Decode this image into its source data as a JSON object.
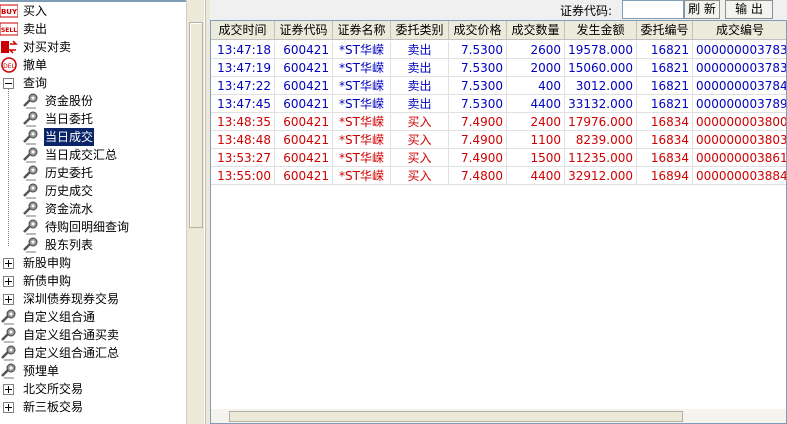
{
  "tree": {
    "items": [
      {
        "label": "买入",
        "icon": "buy-badge-icon",
        "level": 0
      },
      {
        "label": "卖出",
        "icon": "sell-badge-icon",
        "level": 0
      },
      {
        "label": "对买对卖",
        "icon": "swap-icon",
        "level": 0
      },
      {
        "label": "撤单",
        "icon": "cancel-circle-icon",
        "level": 0
      },
      {
        "label": "查询",
        "icon": "minus-box-icon",
        "level": 0
      },
      {
        "label": "资金股份",
        "icon": "gear-icon",
        "level": 1
      },
      {
        "label": "当日委托",
        "icon": "gear-icon",
        "level": 1
      },
      {
        "label": "当日成交",
        "icon": "gear-icon",
        "level": 1,
        "selected": true
      },
      {
        "label": "当日成交汇总",
        "icon": "gear-icon",
        "level": 1
      },
      {
        "label": "历史委托",
        "icon": "gear-icon",
        "level": 1
      },
      {
        "label": "历史成交",
        "icon": "gear-icon",
        "level": 1
      },
      {
        "label": "资金流水",
        "icon": "gear-icon",
        "level": 1
      },
      {
        "label": "待购回明细查询",
        "icon": "gear-icon",
        "level": 1
      },
      {
        "label": "股东列表",
        "icon": "gear-icon",
        "level": 1
      },
      {
        "label": "新股申购",
        "icon": "plus-box-icon",
        "level": 0
      },
      {
        "label": "新债申购",
        "icon": "plus-box-icon",
        "level": 0
      },
      {
        "label": "深圳债券现券交易",
        "icon": "plus-box-icon",
        "level": 0
      },
      {
        "label": "自定义组合通",
        "icon": "gear-icon",
        "level": 0
      },
      {
        "label": "自定义组合通买卖",
        "icon": "gear-icon",
        "level": 0
      },
      {
        "label": "自定义组合通汇总",
        "icon": "gear-icon",
        "level": 0
      },
      {
        "label": "预埋单",
        "icon": "gear-icon",
        "level": 0
      },
      {
        "label": "北交所交易",
        "icon": "plus-box-icon",
        "level": 0
      },
      {
        "label": "新三板交易",
        "icon": "plus-box-icon",
        "level": 0
      }
    ]
  },
  "toolbar": {
    "code_label": "证券代码:",
    "code_value": "",
    "refresh_label": "刷 新",
    "export_label": "输 出"
  },
  "table": {
    "columns": [
      "成交时间",
      "证券代码",
      "证券名称",
      "委托类别",
      "成交价格",
      "成交数量",
      "发生金额",
      "委托编号",
      "成交编号"
    ],
    "rows": [
      [
        "13:47:18",
        "600421",
        "*ST华嵘",
        "卖出",
        "7.5300",
        "2600",
        "19578.000",
        "16821",
        "000000003783"
      ],
      [
        "13:47:19",
        "600421",
        "*ST华嵘",
        "卖出",
        "7.5300",
        "2000",
        "15060.000",
        "16821",
        "000000003783"
      ],
      [
        "13:47:22",
        "600421",
        "*ST华嵘",
        "卖出",
        "7.5300",
        "400",
        "3012.000",
        "16821",
        "000000003784"
      ],
      [
        "13:47:45",
        "600421",
        "*ST华嵘",
        "卖出",
        "7.5300",
        "4400",
        "33132.000",
        "16821",
        "000000003789"
      ],
      [
        "13:48:35",
        "600421",
        "*ST华嵘",
        "买入",
        "7.4900",
        "2400",
        "17976.000",
        "16834",
        "000000003800"
      ],
      [
        "13:48:48",
        "600421",
        "*ST华嵘",
        "买入",
        "7.4900",
        "1100",
        "8239.000",
        "16834",
        "000000003803"
      ],
      [
        "13:53:27",
        "600421",
        "*ST华嵘",
        "买入",
        "7.4900",
        "1500",
        "11235.000",
        "16834",
        "000000003861"
      ],
      [
        "13:55:00",
        "600421",
        "*ST华嵘",
        "买入",
        "7.4800",
        "4400",
        "32912.000",
        "16894",
        "000000003884"
      ]
    ]
  },
  "colors": {
    "sell": "#0000c0",
    "buy": "#d00000",
    "selection": "#0a246a"
  }
}
